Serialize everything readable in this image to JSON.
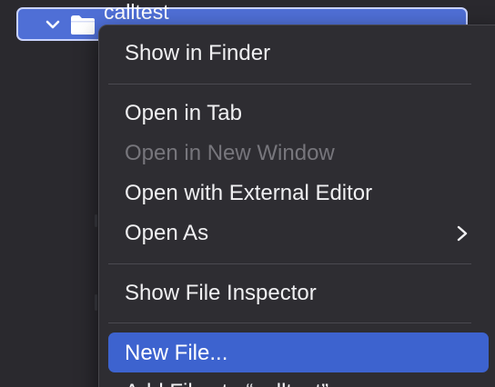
{
  "navigator": {
    "selected_folder": "calltest"
  },
  "context_menu": {
    "items": [
      {
        "label": "Show in Finder",
        "enabled": true
      },
      {
        "label": "Open in Tab",
        "enabled": true
      },
      {
        "label": "Open in New Window",
        "enabled": false
      },
      {
        "label": "Open with External Editor",
        "enabled": true
      },
      {
        "label": "Open As",
        "enabled": true,
        "has_submenu": true
      },
      {
        "label": "Show File Inspector",
        "enabled": true
      },
      {
        "label": "New File...",
        "enabled": true,
        "highlighted": true
      },
      {
        "label": "Add Files to “calltest”...",
        "enabled": true
      }
    ]
  },
  "colors": {
    "highlight": "#3d63cf",
    "selection": "#4f6fd6",
    "menu_background": "#2e2d32"
  },
  "icons": {
    "disclosure": "chevron-down-icon",
    "folder": "folder-icon",
    "submenu": "chevron-right-icon"
  }
}
